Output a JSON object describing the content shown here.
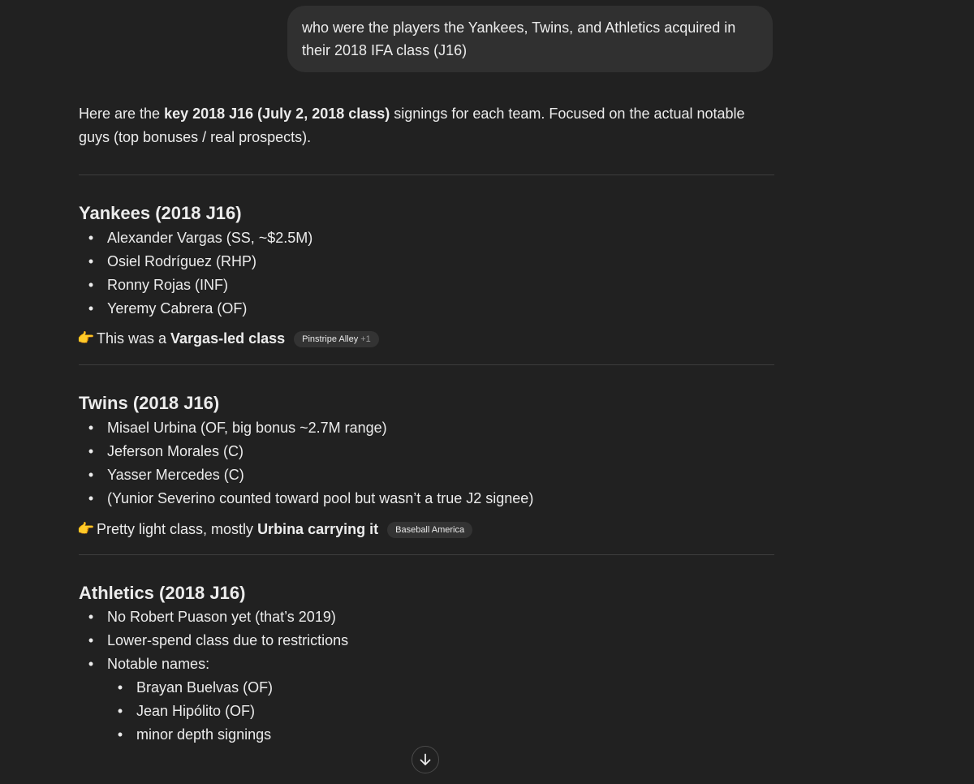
{
  "user_message": {
    "line1": "who were the players the Yankees, Twins, and Athletics acquired in",
    "line2": "their 2018 IFA class (J16)"
  },
  "intro": {
    "prefix": "Here are the ",
    "bold": "key 2018 J16 (July 2, 2018 class)",
    "suffix": " signings for each team. Focused on the actual notable guys (top bonuses / real prospects)."
  },
  "sections": [
    {
      "title": "Yankees (2018 J16)",
      "items": [
        "Alexander Vargas (SS, ~$2.5M)",
        "Osiel Rodríguez (RHP)",
        "Ronny Rojas (INF)",
        "Yeremy Cabrera (OF)"
      ],
      "note_prefix": "This was a ",
      "note_bold": "Vargas-led class",
      "source": "Pinstripe Alley",
      "source_extra": "+1"
    },
    {
      "title": "Twins (2018 J16)",
      "items": [
        "Misael Urbina (OF, big bonus ~2.7M range)",
        "Jeferson Morales (C)",
        "Yasser Mercedes (C)",
        "(Yunior Severino counted toward pool but wasn’t a true J2 signee)"
      ],
      "note_prefix": "Pretty light class, mostly ",
      "note_bold": "Urbina carrying it",
      "source": "Baseball America"
    },
    {
      "title": "Athletics (2018 J16)",
      "items": [
        "No Robert Puason yet (that’s 2019)",
        "Lower-spend class due to restrictions",
        "Notable names:"
      ],
      "subitems": [
        "Brayan Buelvas (OF)",
        "Jean Hipólito (OF)",
        "minor depth signings"
      ]
    }
  ],
  "icons": {
    "pointing_hand": "👉",
    "bullet": "•",
    "scroll_down": "arrow-down-icon"
  }
}
